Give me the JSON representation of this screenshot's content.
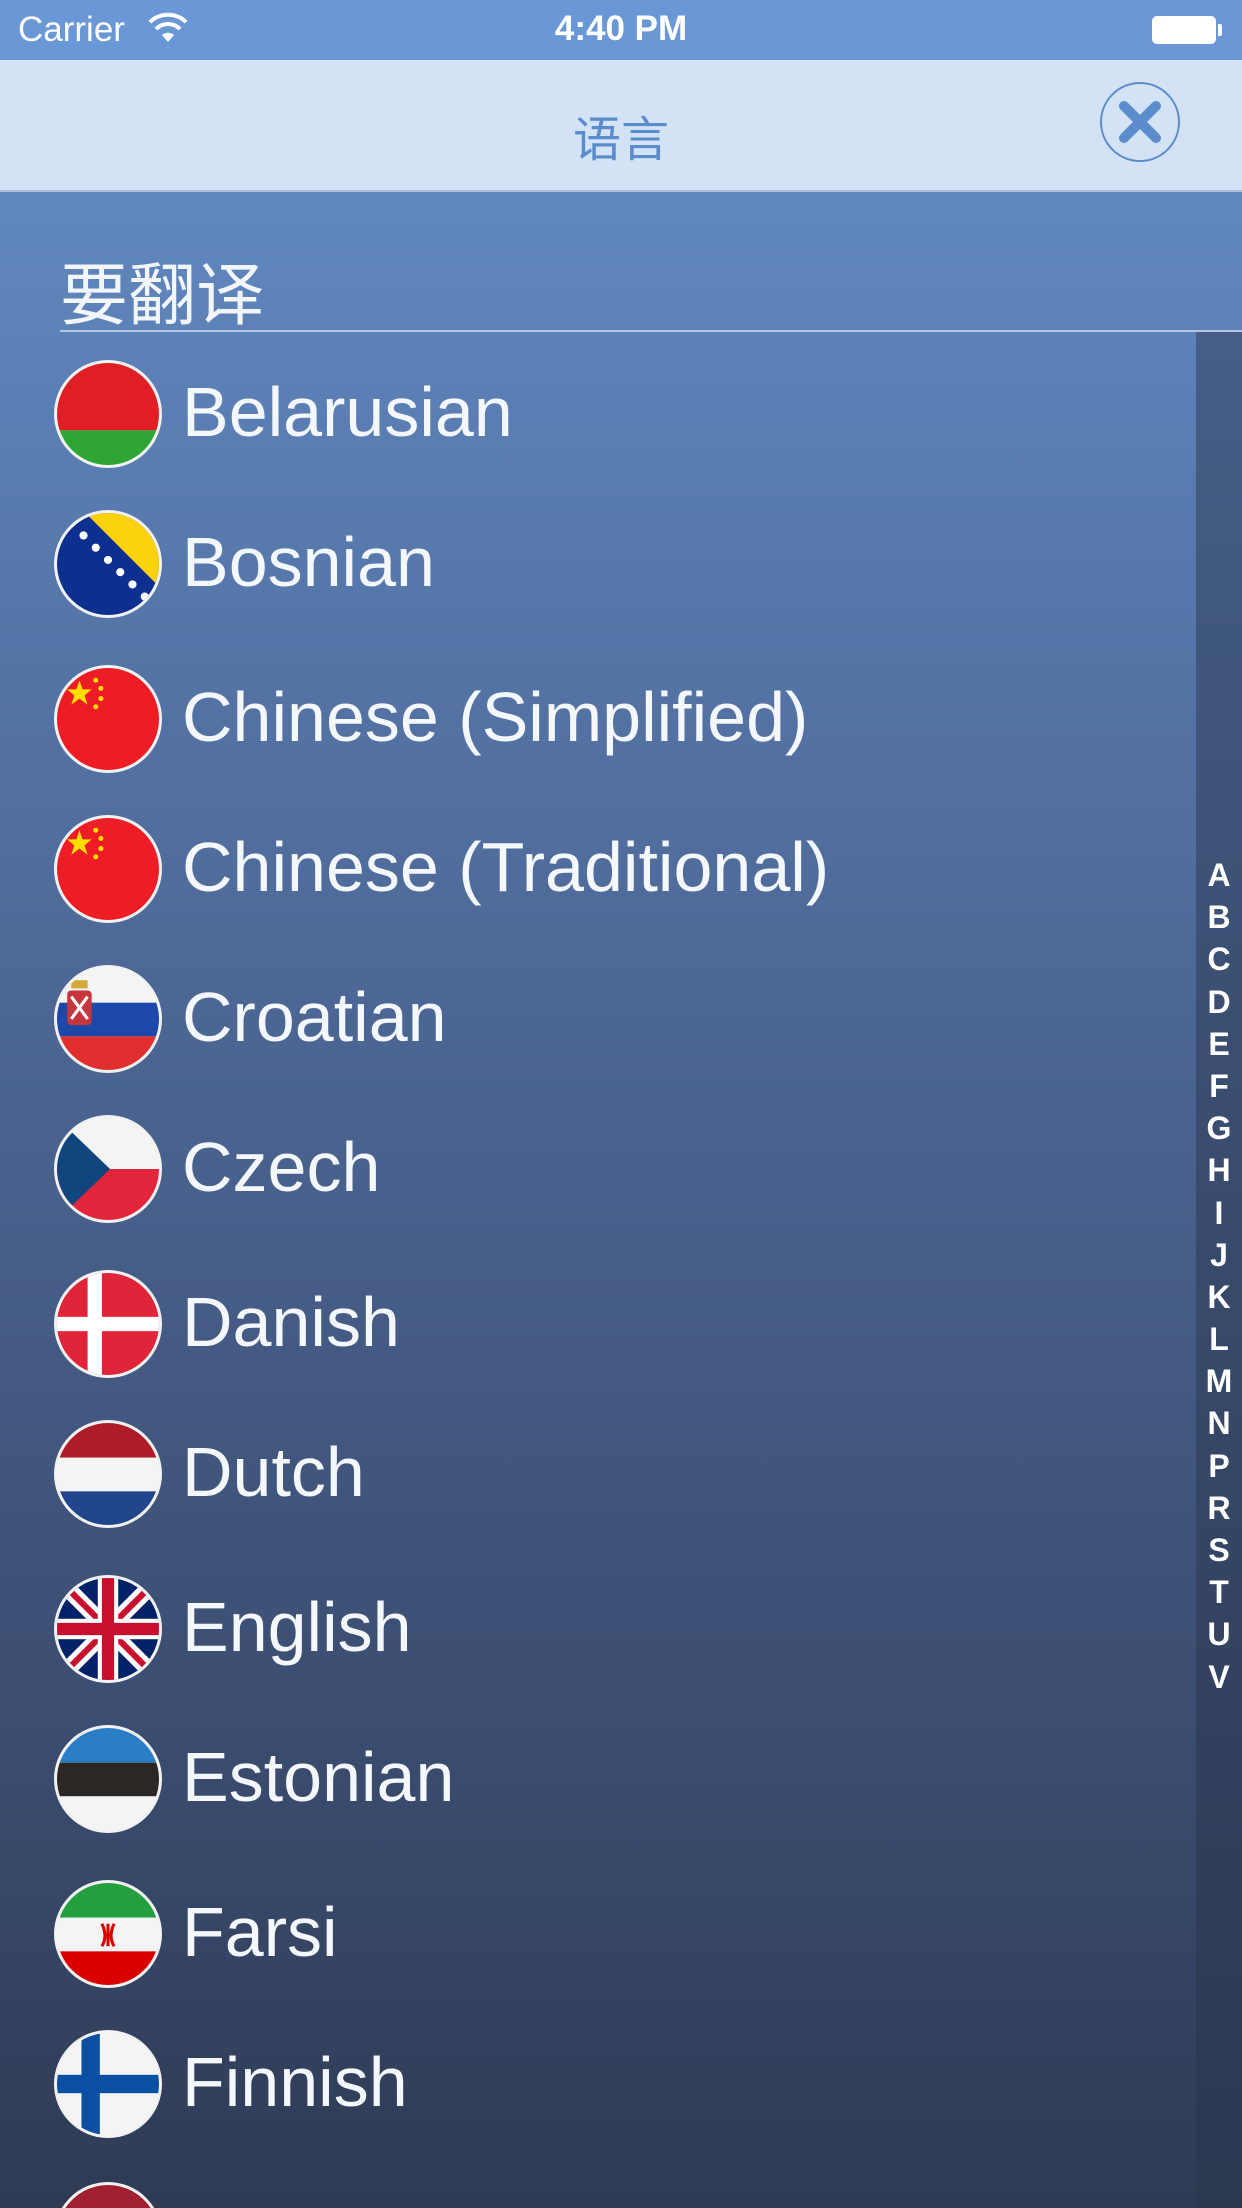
{
  "status_bar": {
    "carrier": "Carrier",
    "time": "4:40 PM"
  },
  "nav": {
    "title": "语言",
    "close_icon": "close-icon"
  },
  "section": {
    "header": "要翻译"
  },
  "languages": [
    {
      "label": "Belarusian",
      "flag": "belarus-flag-icon"
    },
    {
      "label": "Bosnian",
      "flag": "bosnia-flag-icon"
    },
    {
      "label": "Chinese (Simplified)",
      "flag": "china-flag-icon"
    },
    {
      "label": "Chinese (Traditional)",
      "flag": "china-flag-icon"
    },
    {
      "label": "Croatian",
      "flag": "serbia-flag-icon"
    },
    {
      "label": "Czech",
      "flag": "czech-flag-icon"
    },
    {
      "label": "Danish",
      "flag": "denmark-flag-icon"
    },
    {
      "label": "Dutch",
      "flag": "netherlands-flag-icon"
    },
    {
      "label": "English",
      "flag": "uk-flag-icon"
    },
    {
      "label": "Estonian",
      "flag": "estonia-flag-icon"
    },
    {
      "label": "Farsi",
      "flag": "iran-flag-icon"
    },
    {
      "label": "Finnish",
      "flag": "finland-flag-icon"
    }
  ],
  "index_letters": [
    "A",
    "B",
    "C",
    "D",
    "E",
    "F",
    "G",
    "H",
    "I",
    "J",
    "K",
    "L",
    "M",
    "N",
    "P",
    "R",
    "S",
    "T",
    "U",
    "V"
  ],
  "colors": {
    "status_bar": "#6a97d6",
    "nav_bar": "#d3e2f5",
    "accent": "#5b8ccc",
    "background_top": "#6590c9",
    "background_bottom": "#2f3b55"
  }
}
